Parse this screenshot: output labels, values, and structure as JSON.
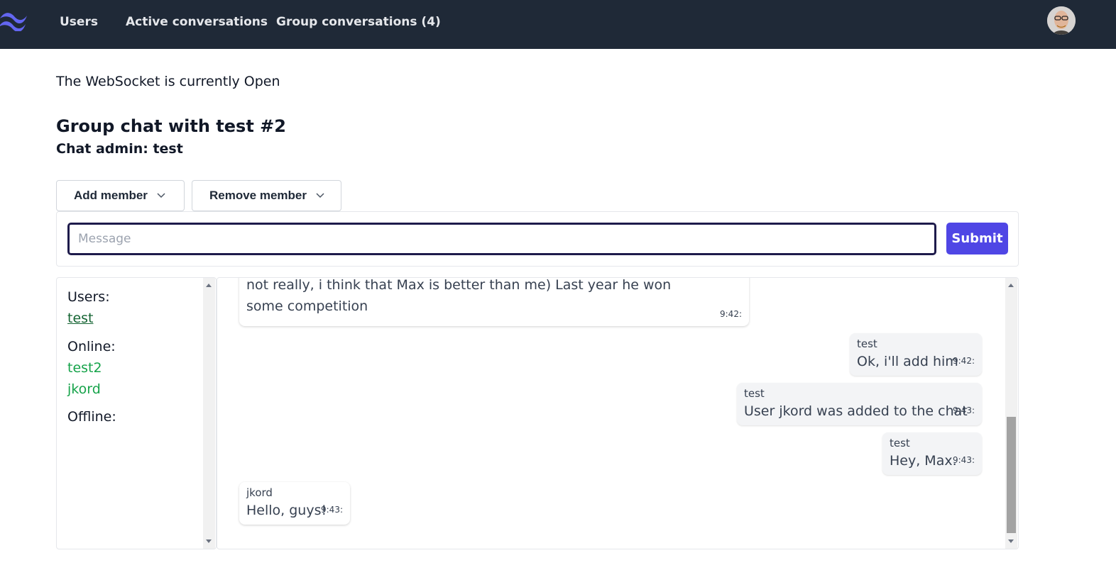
{
  "navbar": {
    "logo_icon": "tailwind-logo-icon",
    "links": [
      "Users",
      "Active conversations",
      "Group conversations (4)"
    ],
    "avatar_icon": "user-avatar-icon"
  },
  "status": {
    "websocket": "The WebSocket is currently Open"
  },
  "chat": {
    "title": "Group chat with test #2",
    "admin": "Chat admin: test",
    "add_member_label": "Add member",
    "remove_member_label": "Remove member",
    "message_placeholder": "Message",
    "message_value": "",
    "submit_label": "Submit"
  },
  "users_panel": {
    "users_label": "Users:",
    "users": [
      "test"
    ],
    "online_label": "Online:",
    "online": [
      "test2",
      "jkord"
    ],
    "offline_label": "Offline:",
    "offline": []
  },
  "messages": [
    {
      "sender": "",
      "text": "not really, i think that Max is better than me) Last year he won some competition",
      "time": "9:42:",
      "side": "left"
    },
    {
      "sender": "test",
      "text": "Ok, i'll add him",
      "time": "9:42:",
      "side": "right"
    },
    {
      "sender": "test",
      "text": "User jkord was added to the chat",
      "time": "9:43:",
      "side": "right"
    },
    {
      "sender": "test",
      "text": "Hey, Max.",
      "time": "9:43:",
      "side": "right"
    },
    {
      "sender": "jkord",
      "text": "Hello, guys!",
      "time": "9:43:",
      "side": "left"
    }
  ],
  "colors": {
    "navbar_bg": "#1f2937",
    "accent": "#4f46e5",
    "online_green": "#16a34a",
    "user_link_green": "#166534"
  }
}
